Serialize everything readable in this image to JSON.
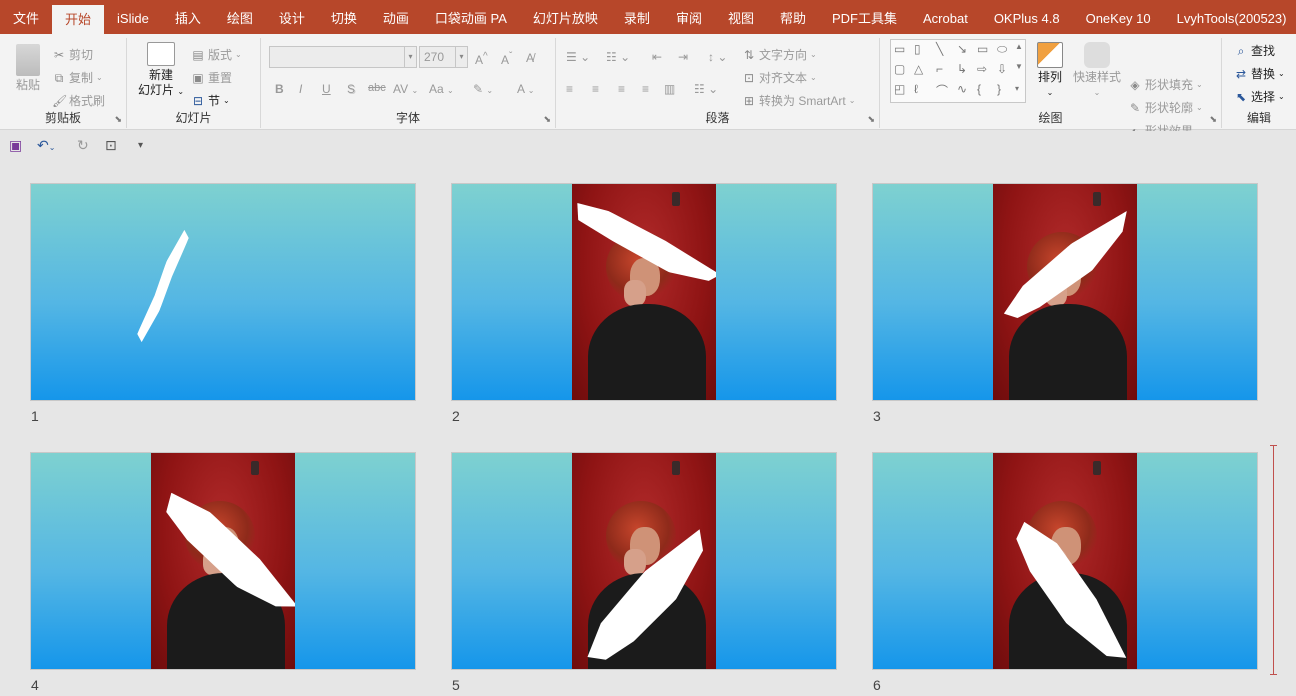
{
  "menu": {
    "tabs": [
      "文件",
      "开始",
      "iSlide",
      "插入",
      "绘图",
      "设计",
      "切换",
      "动画",
      "口袋动画 PA",
      "幻灯片放映",
      "录制",
      "审阅",
      "视图",
      "帮助",
      "PDF工具集",
      "Acrobat",
      "OKPlus 4.8",
      "OneKey 10",
      "LvyhTools(200523)"
    ],
    "active": "开始"
  },
  "ribbon": {
    "clipboard": {
      "label": "剪贴板",
      "paste": "粘贴",
      "cut": "剪切",
      "copy": "复制",
      "format_painter": "格式刷"
    },
    "slides": {
      "label": "幻灯片",
      "new_slide_1": "新建",
      "new_slide_2": "幻灯片",
      "layout": "版式",
      "reset": "重置",
      "section": "节"
    },
    "font": {
      "label": "字体",
      "font_name": "",
      "font_size": "270",
      "bold": "B",
      "italic": "I",
      "underline": "U",
      "shadow": "S",
      "strike": "abc",
      "spacing": "AV",
      "case": "Aa",
      "color": "A"
    },
    "paragraph": {
      "label": "段落",
      "text_direction": "文字方向",
      "align_text": "对齐文本",
      "smartart": "转换为 SmartArt"
    },
    "drawing": {
      "label": "绘图",
      "arrange": "排列",
      "quick_styles": "快速样式",
      "shape_fill": "形状填充",
      "shape_outline": "形状轮廓",
      "shape_effects": "形状效果"
    },
    "editing": {
      "label": "编辑",
      "find": "查找",
      "replace": "替换",
      "select": "选择"
    }
  },
  "slides": [
    {
      "number": "1"
    },
    {
      "number": "2"
    },
    {
      "number": "3"
    },
    {
      "number": "4"
    },
    {
      "number": "5"
    },
    {
      "number": "6"
    }
  ],
  "colors": {
    "accent": "#b7472a",
    "slide_top": "#7ed1d0",
    "slide_bottom": "#1596ea"
  }
}
